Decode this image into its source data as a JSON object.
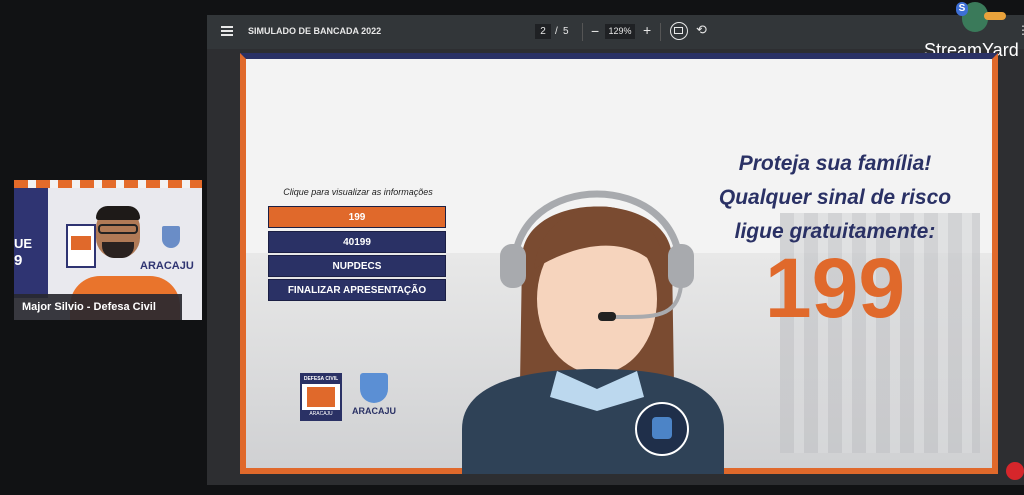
{
  "participant": {
    "name": "Major Silvio - Defesa Civil",
    "wall_text_1": "UE",
    "wall_text_2": "9",
    "logo_text": "ARACAJU"
  },
  "viewer": {
    "title": "SIMULADO DE BANCADA 2022",
    "page_current": "2",
    "page_total": "5",
    "zoom": "129%"
  },
  "slide": {
    "menu_caption": "Clique para visualizar as informações",
    "menu_items": [
      "199",
      "40199",
      "NUPDECS",
      "FINALIZAR APRESENTAÇÃO"
    ],
    "headline_1": "Proteja sua família!",
    "headline_2": "Qualquer sinal de risco",
    "headline_3": "ligue gratuitamente:",
    "big_number": "199",
    "logo_defesa_top": "DEFESA CIVIL",
    "logo_defesa_bottom": "ARACAJU",
    "logo_city": "ARACAJU"
  },
  "brand": {
    "name": "StreamYard"
  },
  "colors": {
    "orange": "#e0692b",
    "navy": "#2a3165"
  }
}
